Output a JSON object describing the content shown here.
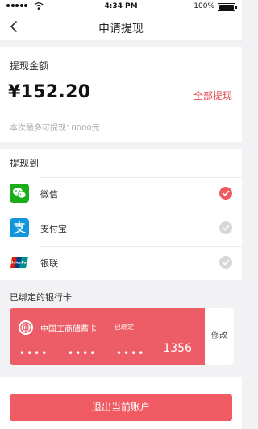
{
  "status_bar": {
    "time": "4:34 PM",
    "battery": "100%"
  },
  "nav": {
    "title": "申请提现"
  },
  "amount": {
    "label": "提现金额",
    "value": "¥152.20",
    "withdraw_all": "全部提现",
    "hint": "本次最多可提现10000元"
  },
  "methods": {
    "title": "提现到",
    "items": [
      {
        "label": "微信",
        "icon": "wechat-icon",
        "selected": true
      },
      {
        "label": "支付宝",
        "icon": "alipay-icon",
        "selected": false
      },
      {
        "label": "银联",
        "icon": "unionpay-icon",
        "selected": false
      }
    ]
  },
  "bound_cards": {
    "title": "已绑定的银行卡",
    "card": {
      "bank": "中国工商储蓄卡",
      "badge": "已绑定",
      "dots": "••••",
      "last4": "1356"
    },
    "edit_label": "修改"
  },
  "logout": {
    "label": "退出当前账户"
  },
  "colors": {
    "accent": "#ef5a63",
    "wechat": "#1aad19",
    "alipay": "#1296db",
    "card": "#ec5d67"
  }
}
